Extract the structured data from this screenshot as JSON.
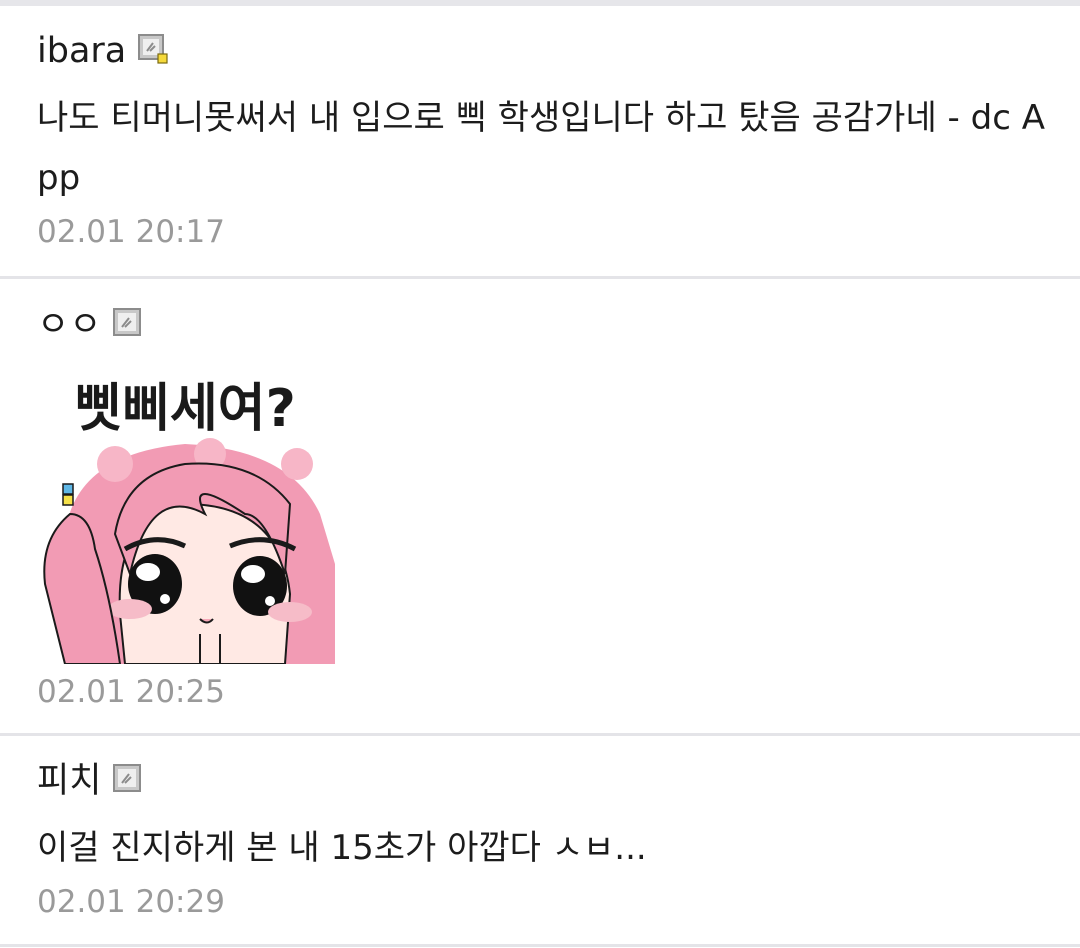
{
  "comments": [
    {
      "nickname": "ibara",
      "icon": "fixed-nick-icon-with-badge",
      "text": "나도 티머니못써서 내 입으로 삑 학생입니다 하고 탔음 공감가네 - dc App",
      "time": "02.01 20:17"
    },
    {
      "nickname": "ㅇㅇ",
      "icon": "fixed-nick-icon",
      "sticker": {
        "caption": "삣삐세여?",
        "hair_color": "#f29bb4",
        "skin_color": "#ffe9e4"
      },
      "time": "02.01 20:25"
    },
    {
      "nickname": "피치",
      "icon": "fixed-nick-icon",
      "text": "이걸 진지하게 본 내 15초가 아깝다 ㅅㅂ...",
      "time": "02.01 20:29"
    }
  ],
  "colors": {
    "divider": "#e4e4e8",
    "timestamp": "#9a9a9a",
    "text": "#1c1c1c"
  }
}
